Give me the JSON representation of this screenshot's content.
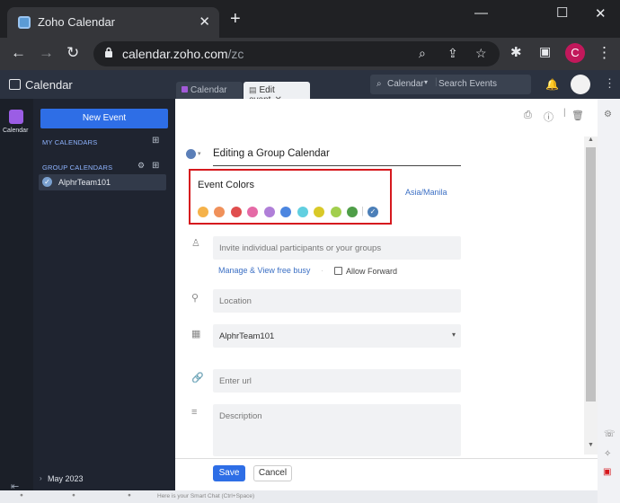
{
  "browser": {
    "tab_title": "Zoho Calendar",
    "url_host": "calendar.zoho.com",
    "url_path": "/zc",
    "profile_initial": "C"
  },
  "app": {
    "brand": "Calendar",
    "tabs": [
      {
        "label": "Calendar"
      },
      {
        "label": "Edit event"
      }
    ],
    "search_scope": "Calendar",
    "search_placeholder": "Search Events",
    "sidebar_label": "Calendar",
    "new_event_label": "New Event",
    "my_calendars_label": "MY CALENDARS",
    "group_calendars_label": "GROUP CALENDARS",
    "calendar_name": "AlphrTeam101",
    "month_label": "May 2023"
  },
  "editor": {
    "title": "Editing a Group Calendar",
    "colors_title": "Event Colors",
    "colors": [
      "#f5b24a",
      "#f0915a",
      "#e04e4e",
      "#e56aa6",
      "#b07fd8",
      "#4c86e0",
      "#61cfe0",
      "#d9c928",
      "#a2cf4e",
      "#4f9e48"
    ],
    "selected_color": "#4c7fb8",
    "timezone": "Asia/Manila",
    "participants_placeholder": "Invite individual participants or your groups",
    "manage_link": "Manage & View free busy",
    "allow_forward_label": "Allow Forward",
    "location_placeholder": "Location",
    "calendar_value": "AlphrTeam101",
    "url_placeholder": "Enter url",
    "description_placeholder": "Description",
    "save_label": "Save",
    "cancel_label": "Cancel",
    "smart_chat_hint": "Here is your Smart Chat (Ctrl+Space)"
  }
}
